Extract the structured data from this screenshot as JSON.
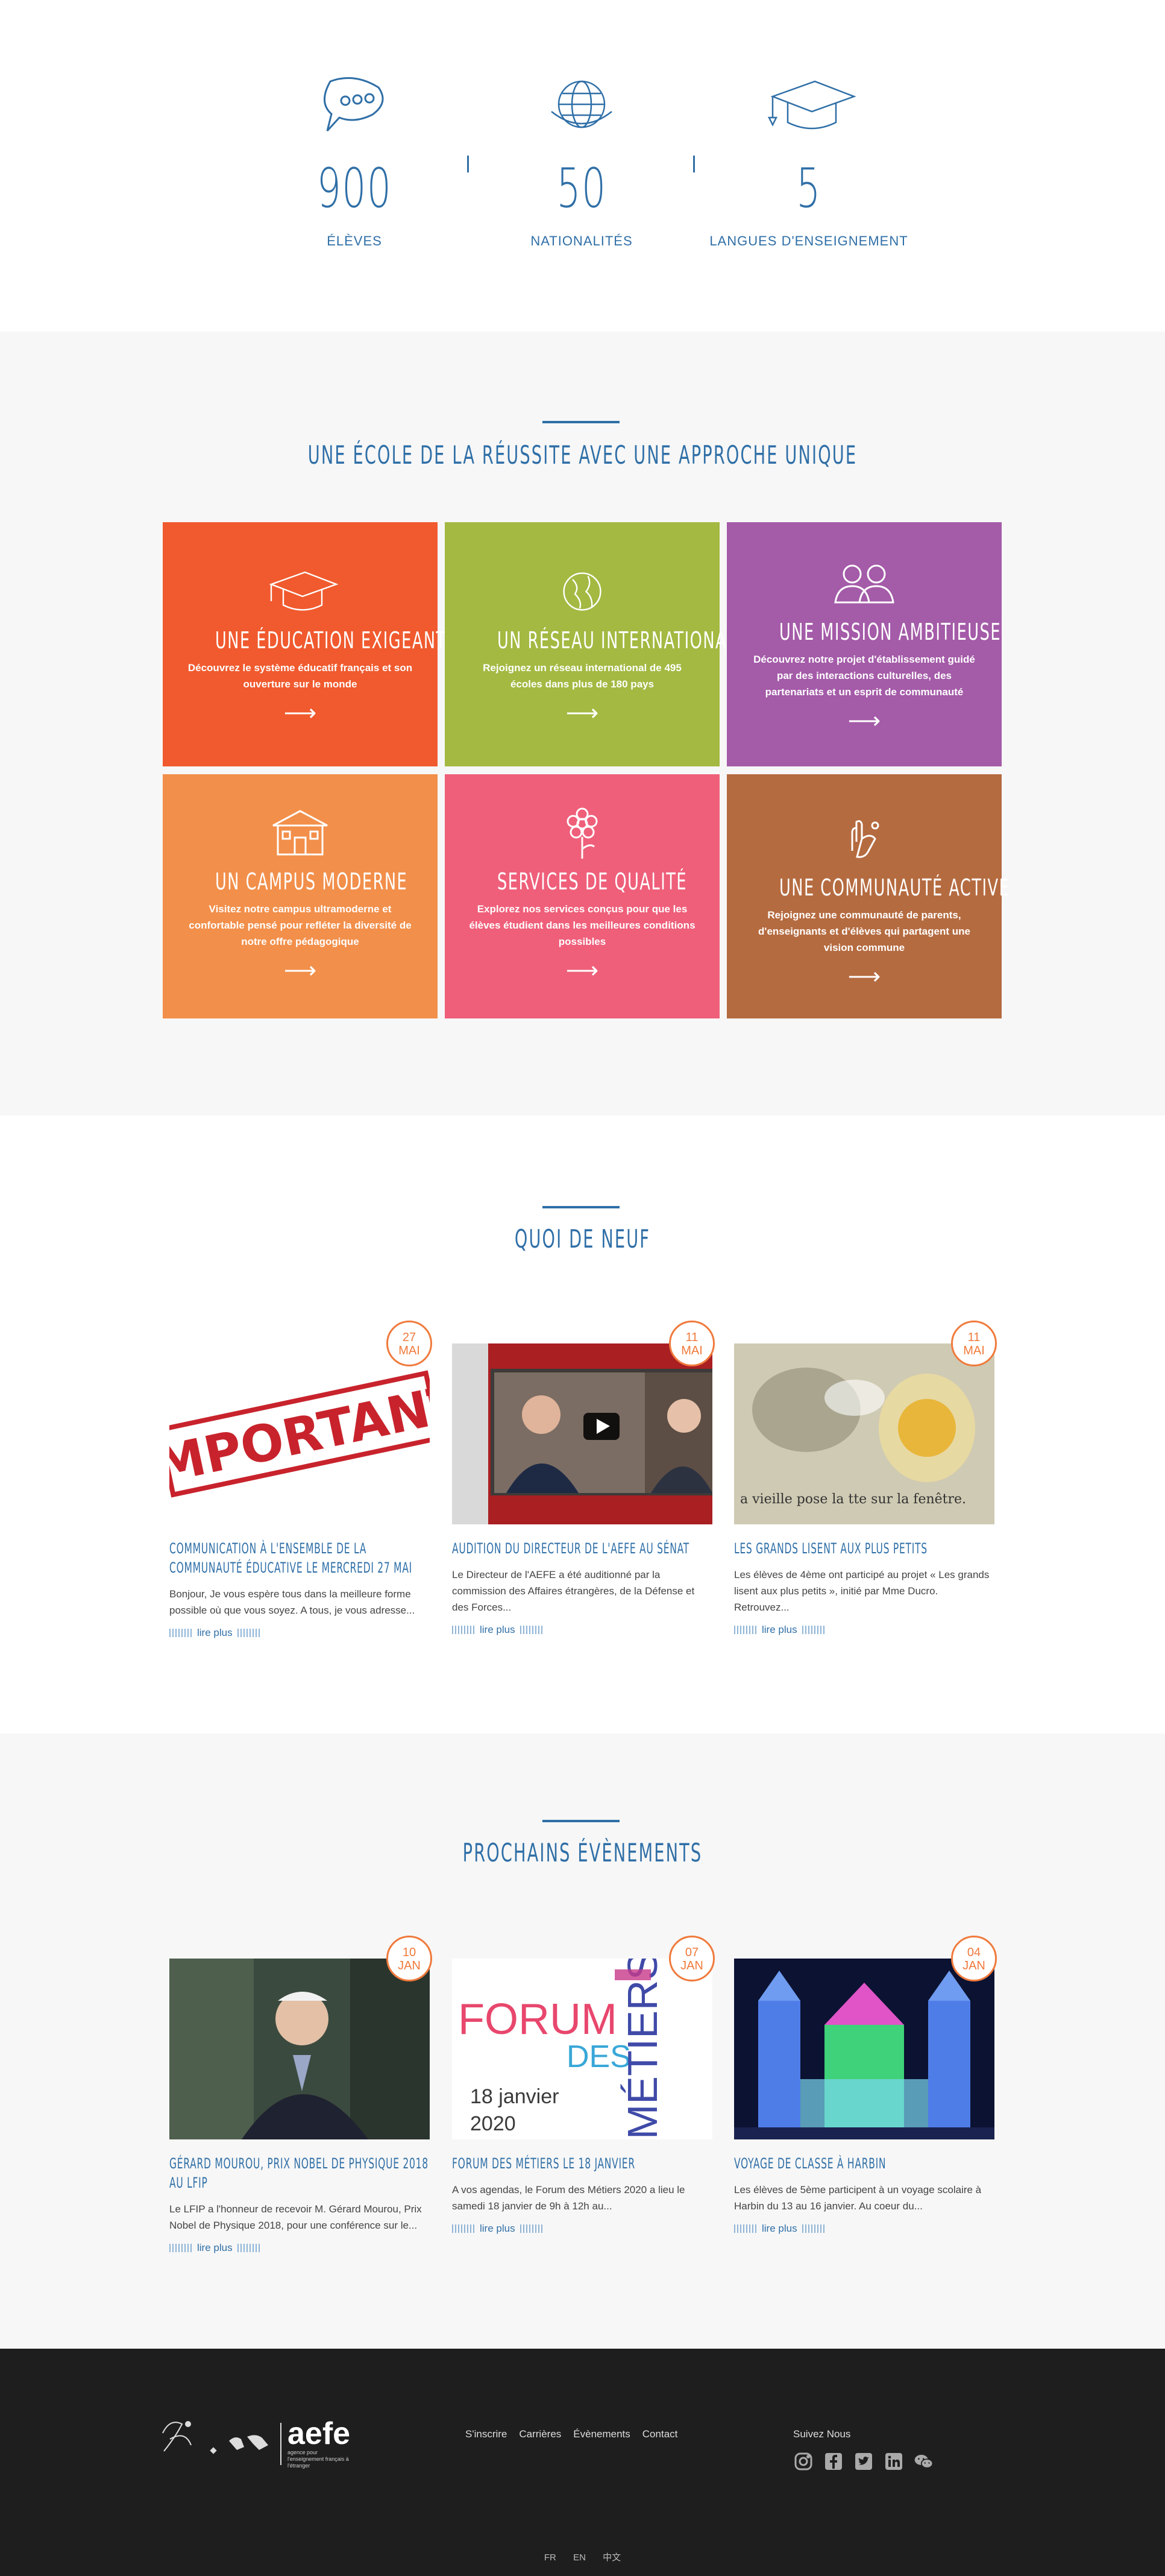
{
  "stats": [
    {
      "icon": "speech-bubble-icon",
      "value": "900",
      "label": "ÉLÈVES"
    },
    {
      "icon": "globe-icon",
      "value": "50",
      "label": "NATIONALITÉS"
    },
    {
      "icon": "graduation-cap-icon",
      "value": "5",
      "label": "LANGUES D'ENSEIGNEMENT"
    }
  ],
  "features": {
    "title": "Une école de la réussite avec une approche unique",
    "tiles": [
      {
        "icon": "graduation-cap-icon",
        "title": "Une éducation exigeante",
        "desc": "Découvrez le système éducatif français et son ouverture sur le monde",
        "color": "#f05a2e"
      },
      {
        "icon": "globe-icon",
        "title": "Un réseau international",
        "desc": "Rejoignez un réseau international de 495 écoles dans plus de 180 pays",
        "color": "#a3b942"
      },
      {
        "icon": "people-icon",
        "title": "Une mission ambitieuse",
        "desc": "Découvrez notre projet d'établissement guidé par des interactions culturelles, des partenariats et un esprit de communauté",
        "color": "#a45ba8"
      },
      {
        "icon": "school-building-icon",
        "title": "Un campus moderne",
        "desc": "Visitez notre campus ultramoderne et confortable pensé pour refléter la diversité de notre offre pédagogique",
        "color": "#f28f4a"
      },
      {
        "icon": "flower-icon",
        "title": "Services de qualité",
        "desc": "Explorez nos services conçus pour que les élèves étudient dans les meilleures conditions possibles",
        "color": "#ef5f7a"
      },
      {
        "icon": "hands-icon",
        "title": "Une communauté active",
        "desc": "Rejoignez une communauté de parents, d'enseignants et d'élèves qui partagent une vision commune",
        "color": "#b56b40"
      }
    ],
    "arrow": "⟶"
  },
  "news": {
    "title": "Quoi de neuf",
    "items": [
      {
        "day": "27",
        "month": "MAI",
        "title": "Communication à l'ensemble de la communauté éducative le mercredi 27 mai",
        "excerpt": "Bonjour,  Je vous espère tous dans la meilleure forme possible où que vous soyez. A tous, je vous adresse...",
        "more": "lire plus",
        "image_text": "IMPORTANT"
      },
      {
        "day": "11",
        "month": "MAI",
        "title": "Audition du directeur de l'AEFE au Sénat",
        "excerpt": "Le Directeur de l'AEFE a été auditionné par la commission des Affaires étrangères, de la Défense et des Forces...",
        "more": "lire plus",
        "image_text": ""
      },
      {
        "day": "11",
        "month": "MAI",
        "title": "Les grands lisent aux plus petits",
        "excerpt": "Les élèves de 4ème ont participé au projet « Les grands lisent aux plus petits », initié par Mme Ducro.  Retrouvez...",
        "more": "lire plus",
        "image_text": "a vieille pose la tte sur la fenêtre."
      }
    ]
  },
  "events": {
    "title": "Prochains évènements",
    "items": [
      {
        "day": "10",
        "month": "JAN",
        "title": "Gérard Mourou, Prix Nobel de Physique 2018 au LFIP",
        "excerpt": "Le LFIP a l'honneur de recevoir M. Gérard Mourou, Prix Nobel de Physique 2018, pour une conférence sur le...",
        "more": "lire plus"
      },
      {
        "day": "07",
        "month": "JAN",
        "title": "Forum des Métiers le 18 janvier",
        "excerpt": "A vos agendas, le Forum des Métiers 2020 a lieu le samedi 18 janvier de 9h à 12h au...",
        "more": "lire plus",
        "poster": {
          "l1": "FORUM",
          "l2": "DES",
          "l3": "MÉTIERS",
          "date": "18 janvier",
          "year": "2020"
        }
      },
      {
        "day": "04",
        "month": "JAN",
        "title": "Voyage de classe à Harbin",
        "excerpt": "Les élèves de 5ème participent à un voyage scolaire à Harbin du 13 au 16 janvier. Au coeur du...",
        "more": "lire plus"
      }
    ]
  },
  "footer": {
    "links": [
      "S'inscrire",
      "Carrières",
      "Évènements",
      "Contact"
    ],
    "follow_label": "Suivez Nous",
    "socials": [
      "instagram-icon",
      "facebook-icon",
      "twitter-icon",
      "linkedin-icon",
      "wechat-icon"
    ],
    "logo_text": "aefe",
    "logo_sub": "agence pour l'enseignement français à l'étranger",
    "languages": [
      "FR",
      "EN",
      "中文"
    ]
  },
  "colors": {
    "brand_blue": "#2f6fa7",
    "accent_orange": "#f07a3c",
    "footer_bg": "#1e1e1e"
  }
}
